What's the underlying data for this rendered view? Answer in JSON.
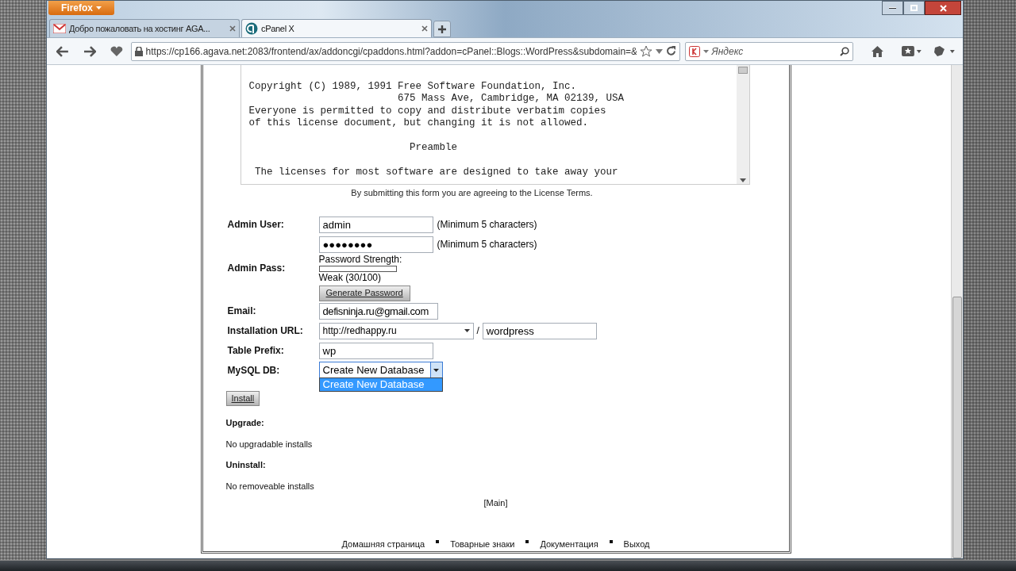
{
  "browser": {
    "menu_button": "Firefox",
    "tabs": [
      {
        "title": "Добро пожаловать на хостинг AGA...",
        "kind": "mail",
        "selected": false
      },
      {
        "title": "cPanel X",
        "kind": "cpanel",
        "selected": true
      }
    ],
    "address": "https://cp166.agava.net:2083/frontend/ax/addoncgi/cpaddons.html?addon=cPanel::Blogs::WordPress&subdomain=&",
    "search_placeholder": "Яндекс"
  },
  "license": {
    "paragraphs": [
      [
        "Copyright (C) 1989, 1991 Free Software Foundation, Inc.",
        "                         675 Mass Ave, Cambridge, MA 02139, USA",
        "Everyone is permitted to copy and distribute verbatim copies",
        "of this license document, but changing it is not allowed."
      ],
      [
        "                           Preamble"
      ],
      [
        " The licenses for most software are designed to take away your"
      ]
    ],
    "note": "By submitting this form you are agreeing to the License Terms."
  },
  "form": {
    "admin_user": {
      "label": "Admin User:",
      "value": "admin",
      "hint": "(Minimum 5 characters)"
    },
    "admin_pass": {
      "label": "Admin Pass:",
      "value": "●●●●●●●●",
      "hint": "(Minimum 5 characters)",
      "strength_label": "Password Strength:",
      "level": 0,
      "rating": "Weak (30/100)",
      "generate_button": "Generate Password"
    },
    "email": {
      "label": "Email:",
      "value": "defisninja.ru@gmail.com"
    },
    "installation_url": {
      "label": "Installation URL:",
      "domain": "http://redhappy.ru",
      "separator": "/",
      "path": "wordpress"
    },
    "table_prefix": {
      "label": "Table Prefix:",
      "value": "wp"
    },
    "mysql_db": {
      "label": "MySQL DB:",
      "value": "Create New Database",
      "expanded": true,
      "options": [
        {
          "label": "Create New Database",
          "selected": true
        }
      ]
    },
    "install_button": "Install"
  },
  "sections": [
    {
      "title": "Upgrade:",
      "text": "No upgradable installs"
    },
    {
      "title": "Uninstall:",
      "text": "No removeable installs"
    }
  ],
  "main_link": "[Main]",
  "footer_links": [
    "Домашняя страница",
    "Товарные знаки",
    "Документация",
    "Выход"
  ]
}
